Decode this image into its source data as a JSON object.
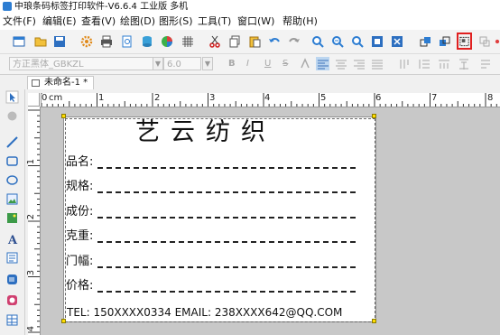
{
  "window": {
    "title": "中琅条码标签打印软件-V6.6.4 工业版 多机"
  },
  "menu": {
    "items": [
      "文件(F)",
      "编辑(E)",
      "查看(V)",
      "绘图(D)",
      "图形(S)",
      "工具(T)",
      "窗口(W)",
      "帮助(H)"
    ]
  },
  "format_bar": {
    "font_name": "方正黑体_GBKZL",
    "font_size": "6.0",
    "bold": "B",
    "italic": "I",
    "underline": "U",
    "strike": "S"
  },
  "document_tab": {
    "label": "未命名-1 *"
  },
  "ruler": {
    "unit": "cm",
    "top_numbers": [
      "0",
      "1",
      "2",
      "3",
      "4",
      "5",
      "6",
      "7",
      "8"
    ],
    "left_numbers": [
      "1",
      "2",
      "3",
      "4"
    ]
  },
  "label": {
    "title": "艺云纺织",
    "fields": [
      {
        "label": "品名:"
      },
      {
        "label": "规格:"
      },
      {
        "label": "成份:"
      },
      {
        "label": "克重:"
      },
      {
        "label": "门幅:"
      },
      {
        "label": "价格:"
      }
    ],
    "contact": "TEL: 150XXXX0334  EMAIL: 238XXXX642@QQ.COM"
  },
  "colors": {
    "highlight_border": "#e02020",
    "handle": "#ffdd00",
    "canvas_bg": "#c8c8c8"
  }
}
